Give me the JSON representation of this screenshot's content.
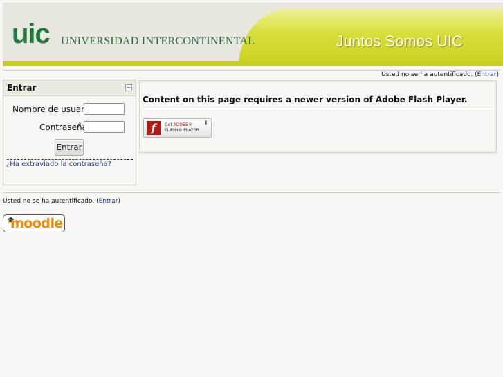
{
  "header": {
    "logo_mark": "uic",
    "logo_text": "UNIVERSIDAD INTERCONTINENTAL",
    "slogan": "Juntos Somos UIC"
  },
  "login_info_top": {
    "text": "Usted no se ha autentificado. (",
    "link": "Entrar",
    "close": ")"
  },
  "login_block": {
    "title": "Entrar",
    "collapse_icon": "−",
    "username_label": "Nombre de usuario",
    "username_value": "",
    "password_label": "Contraseña",
    "password_value": "",
    "submit_label": "Entrar",
    "forgot_link": "¿Ha extraviado la contraseña?"
  },
  "main": {
    "flash_message": "Content on this page requires a newer version of Adobe Flash Player.",
    "badge": {
      "line1_prefix": "Get ",
      "line1_brand": "ADOBE®",
      "line2": "FLASH® PLAYER",
      "icon_letter": "f",
      "icon_name": "adobe-flash-icon"
    }
  },
  "login_info_bottom": {
    "text": "Usted no se ha autentificado. (",
    "link": "Entrar",
    "close": ")"
  },
  "footer": {
    "moodle_logo_text": "moodle"
  },
  "colors": {
    "brand_green": "#1f7a3c",
    "banner_lime": "#c9cf22",
    "link_blue": "#1a3e9c",
    "moodle_orange": "#f08a00",
    "flash_red": "#b21a12"
  }
}
